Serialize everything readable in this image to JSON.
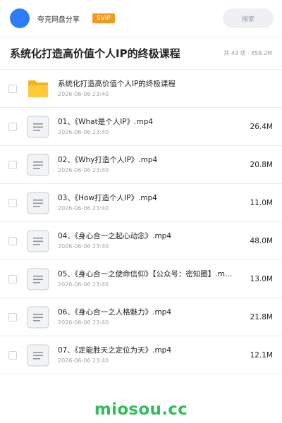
{
  "header": {
    "share_name": "夸克网盘分享",
    "badge": "SVIP",
    "search_label": "搜索",
    "avatar_color": "#2f7df6",
    "badge_color": "#f39a1e"
  },
  "title_row": {
    "title": "系统化打造高价值个人IP的终极课程",
    "meta": "共 43 项 · 858.2M"
  },
  "files": [
    {
      "name": "系统化打造高价值个人IP的终极课程",
      "date": "2026-06-06 23:40",
      "size": "",
      "icon": "folder-icon"
    },
    {
      "name": "01、《What是个人IP》.mp4",
      "date": "2026-06-06 23:40",
      "size": "26.4M",
      "icon": "document-icon"
    },
    {
      "name": "02、《Why打造个人IP》.mp4",
      "date": "2026-06-06 23:40",
      "size": "20.8M",
      "icon": "document-icon"
    },
    {
      "name": "03、《How打造个人IP》.mp4",
      "date": "2026-06-06 23:40",
      "size": "11.0M",
      "icon": "document-icon"
    },
    {
      "name": "04、《身心合一之起心动念》.mp4",
      "date": "2026-06-06 23:40",
      "size": "48.0M",
      "icon": "document-icon"
    },
    {
      "name": "05、《身心合一之使命信仰》【公众号：密知圈】.m…",
      "date": "2026-06-06 23:40",
      "size": "13.0M",
      "icon": "document-icon"
    },
    {
      "name": "06、《身心合一之人格魅力》.mp4",
      "date": "2026-06-06 23:40",
      "size": "21.8M",
      "icon": "document-icon"
    },
    {
      "name": "07、《定能胜天之定位为天》.mp4",
      "date": "2026-06-06 23:40",
      "size": "12.1M",
      "icon": "document-icon"
    }
  ],
  "watermark": "miosou.cc",
  "watermark_color": "#2fbf5a"
}
